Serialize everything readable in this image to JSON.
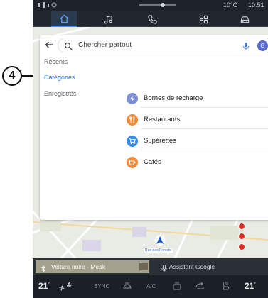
{
  "status": {
    "temperature": "10°C",
    "time": "10:51"
  },
  "topnav": {
    "items": [
      "home-icon",
      "music-icon",
      "phone-icon",
      "apps-icon",
      "car-icon"
    ],
    "active": "home-icon",
    "accent": "#3f8cff"
  },
  "search": {
    "placeholder": "Chercher partout"
  },
  "avatar": {
    "initial": "G"
  },
  "sidebar": {
    "items": [
      {
        "label": "Récents"
      },
      {
        "label": "Catégories"
      },
      {
        "label": "Enregistrés"
      }
    ],
    "selected": "Catégories"
  },
  "categories": [
    {
      "label": "Bornes de recharge",
      "icon": "charging-station-icon",
      "color": "#7b8fd6"
    },
    {
      "label": "Restaurants",
      "icon": "restaurant-icon",
      "color": "#f08a3a"
    },
    {
      "label": "Supérettes",
      "icon": "shopping-cart-icon",
      "color": "#3b8be8"
    },
    {
      "label": "Cafés",
      "icon": "cafe-icon",
      "color": "#f08a3a"
    }
  ],
  "map": {
    "street_label": "Rue des Forests"
  },
  "media": {
    "device": "Voiture noire - Meak",
    "assistant": "Assistant Google"
  },
  "climate": {
    "temp_left": "21",
    "temp_right": "21",
    "degree": "°",
    "fan_level": "4",
    "sync": "SYNC",
    "ac": "A/C"
  },
  "callout": {
    "number": "4"
  }
}
